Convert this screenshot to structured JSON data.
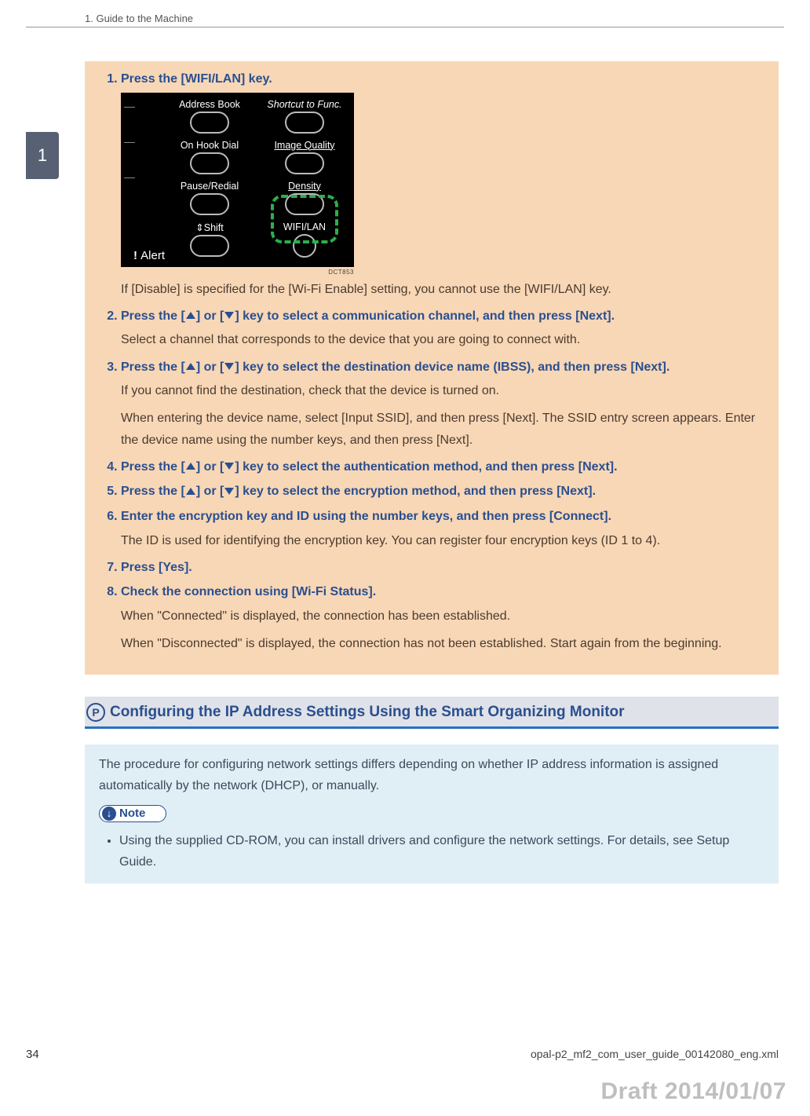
{
  "header": {
    "running_head": "1. Guide to the Machine",
    "chapter_number": "1"
  },
  "box": {
    "steps": {
      "s1": {
        "head": "Press the [WIFI/LAN] key.",
        "body1": "If [Disable] is specified for the [Wi-Fi Enable] setting, you cannot use the [WIFI/LAN] key."
      },
      "s2": {
        "head_pre": "Press the [",
        "head_mid": "] or [",
        "head_post": "] key to select a communication channel, and then press [Next].",
        "body1": "Select a channel that corresponds to the device that you are going to connect with."
      },
      "s3": {
        "head_pre": "Press the [",
        "head_mid": "] or [",
        "head_post": "] key to select the destination device name (IBSS), and then press [Next].",
        "body1": "If you cannot find the destination, check that the device is turned on.",
        "body2": "When entering the device name, select [Input SSID], and then press [Next]. The SSID entry screen appears. Enter the device name using the number keys, and then press [Next]."
      },
      "s4": {
        "head_pre": "Press the [",
        "head_mid": "] or [",
        "head_post": "] key to select the authentication method, and then press [Next]."
      },
      "s5": {
        "head_pre": "Press the [",
        "head_mid": "] or [",
        "head_post": "] key to select the encryption method, and then press [Next]."
      },
      "s6": {
        "head": "Enter the encryption key and ID using the number keys, and then press [Connect].",
        "body1": "The ID is used for identifying the encryption key. You can register four encryption keys (ID 1 to 4)."
      },
      "s7": {
        "head": "Press [Yes]."
      },
      "s8": {
        "head": "Check the connection using [Wi-Fi Status].",
        "body1": "When \"Connected\" is displayed, the connection has been established.",
        "body2": "When \"Disconnected\" is displayed, the connection has not been established. Start again from the beginning."
      }
    },
    "fig": {
      "labels": {
        "address_book": "Address Book",
        "on_hook": "On Hook Dial",
        "pause_redial": "Pause/Redial",
        "shift": "Shift",
        "shortcut": "Shortcut to Func.",
        "image_quality": "Image Quality",
        "density": "Density",
        "wifi_lan": "WIFI/LAN",
        "alert": "Alert"
      },
      "code": "DCT853"
    }
  },
  "section2": {
    "badge": "P",
    "title": "Configuring the IP Address Settings Using the Smart Organizing Monitor",
    "intro": "The procedure for configuring network settings differs depending on whether IP address information is assigned automatically by the network (DHCP), or manually.",
    "note_label": "Note",
    "note_bullet": "Using the supplied CD-ROM, you can install drivers and configure the network settings. For details, see Setup Guide."
  },
  "footer": {
    "page": "34",
    "file": "opal-p2_mf2_com_user_guide_00142080_eng.xml",
    "draft": "Draft 2014/01/07"
  }
}
